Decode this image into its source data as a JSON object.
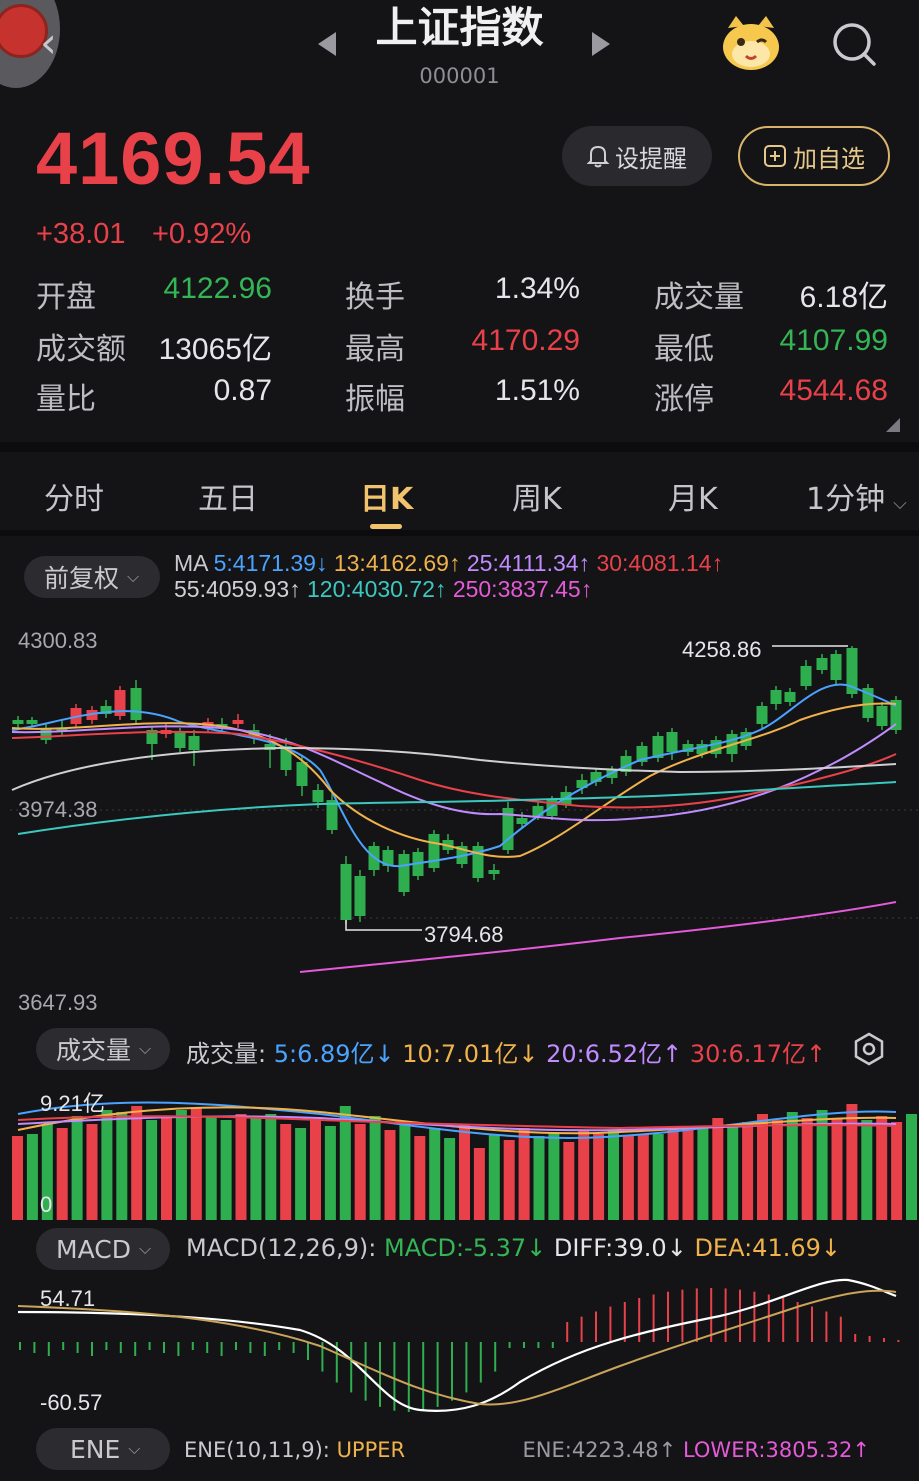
{
  "header": {
    "title": "上证指数",
    "code": "000001"
  },
  "quote": {
    "price": "4169.54",
    "change": "+38.01",
    "change_pct": "+0.92%",
    "alert_label": "设提醒",
    "watch_label": "加自选"
  },
  "stats": [
    {
      "label": "开盘",
      "value": "4122.96",
      "color": "#34b556"
    },
    {
      "label": "换手",
      "value": "1.34%",
      "color": "#e6e6ea"
    },
    {
      "label": "成交量",
      "value": "6.18亿",
      "color": "#e6e6ea"
    },
    {
      "label": "成交额",
      "value": "13065亿",
      "color": "#e6e6ea"
    },
    {
      "label": "最高",
      "value": "4170.29",
      "color": "#e8414a"
    },
    {
      "label": "最低",
      "value": "4107.99",
      "color": "#34b556"
    },
    {
      "label": "量比",
      "value": "0.87",
      "color": "#e6e6ea"
    },
    {
      "label": "振幅",
      "value": "1.51%",
      "color": "#e6e6ea"
    },
    {
      "label": "涨停",
      "value": "4544.68",
      "color": "#e8414a"
    }
  ],
  "tabs": [
    "分时",
    "五日",
    "日K",
    "周K",
    "月K",
    "1分钟"
  ],
  "active_tab": "日K",
  "kline": {
    "adjust_label": "前复权",
    "ma_prefix": "MA",
    "ma": [
      {
        "text": "5:4171.39↓",
        "color": "#4aa3ff"
      },
      {
        "text": "13:4162.69↑",
        "color": "#f0b24a"
      },
      {
        "text": "25:4111.34↑",
        "color": "#c08cff"
      },
      {
        "text": "30:4081.14↑",
        "color": "#e8414a"
      },
      {
        "text": "55:4059.93↑",
        "color": "#d0d0d4"
      },
      {
        "text": "120:4030.72↑",
        "color": "#3cc8c0"
      },
      {
        "text": "250:3837.45↑",
        "color": "#e45ad8"
      }
    ],
    "axis_top": "4300.83",
    "axis_mid": "3974.38",
    "axis_bottom": "3647.93",
    "high_label": "4258.86",
    "low_label": "3794.68"
  },
  "volume": {
    "chip_label": "成交量",
    "legend_prefix": "成交量:",
    "legend": [
      {
        "text": "5:6.89亿↓",
        "color": "#4aa3ff"
      },
      {
        "text": "10:7.01亿↓",
        "color": "#f0b24a"
      },
      {
        "text": "20:6.52亿↑",
        "color": "#c08cff"
      },
      {
        "text": "30:6.17亿↑",
        "color": "#e8414a"
      }
    ],
    "axis_top": "9.21亿",
    "axis_zero": "0"
  },
  "macd": {
    "chip_label": "MACD",
    "params": "MACD(12,26,9):",
    "macd_text": "MACD:-5.37↓",
    "diff_text": "DIFF:39.0↓",
    "dea_text": "DEA:41.69↓",
    "axis_top": "54.71",
    "axis_bottom": "-60.57"
  },
  "ene": {
    "chip_label": "ENE",
    "params": "ENE(10,11,9):",
    "upper_text": "UPPER",
    "ene_text": "ENE:4223.48↑",
    "lower_text": "LOWER:3805.32↑"
  }
}
